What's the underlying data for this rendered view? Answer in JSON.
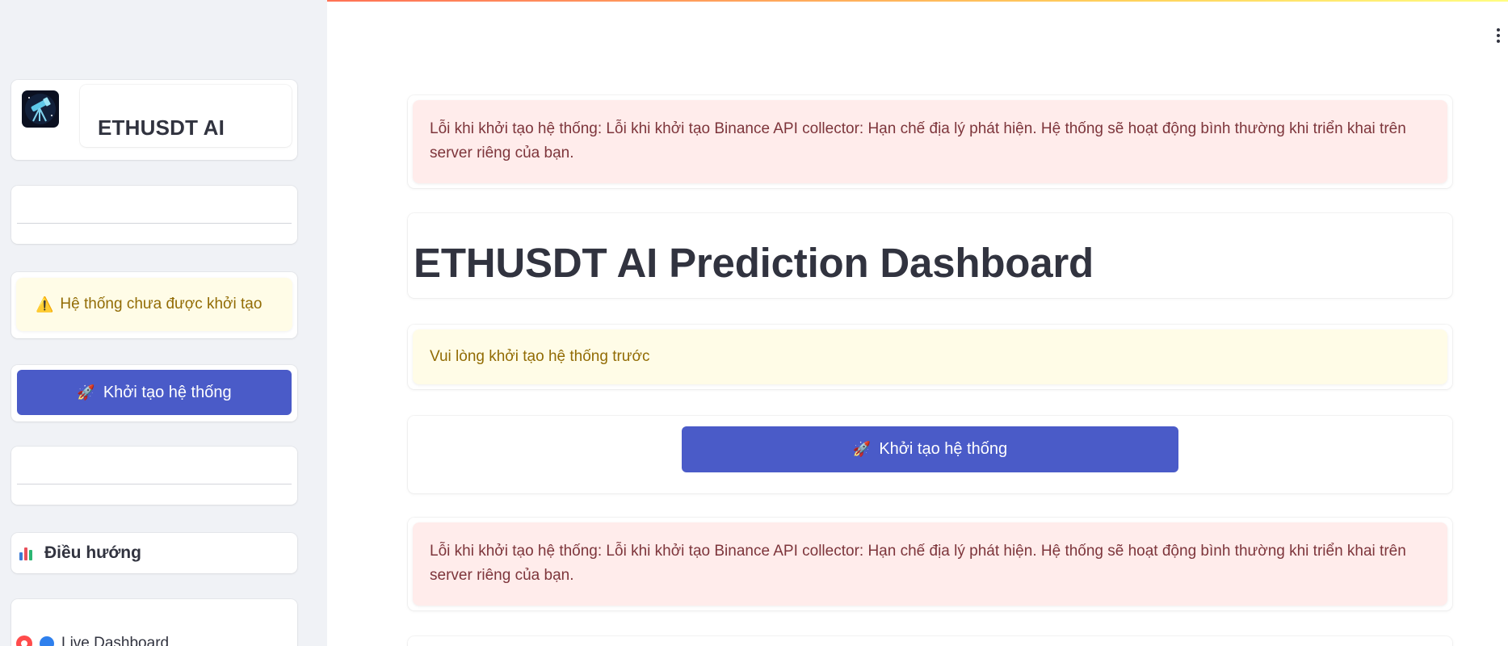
{
  "app": {
    "accent_color": "#4a5bc8",
    "gradient_colors": [
      "#ff4b4b",
      "#ffd25c",
      "#fffd80"
    ]
  },
  "sidebar": {
    "brand_name": "ETHUSDT AI",
    "logo_icon": "telescope-icon",
    "status_warning": {
      "icon": "⚠️",
      "text": "Hệ thống chưa được khởi tạo"
    },
    "init_button": {
      "icon": "🚀",
      "label": "Khởi tạo hệ thống"
    },
    "navigation": {
      "icon": "bar-chart-icon",
      "title": "Điều hướng",
      "items": [
        {
          "icon": "globe-icon",
          "label": "Live Dashboard",
          "selected": true
        }
      ]
    }
  },
  "main": {
    "error_message_top": "Lỗi khi khởi tạo hệ thống: Lỗi khi khởi tạo Binance API collector: Hạn chế địa lý phát hiện. Hệ thống sẽ hoạt động bình thường khi triển khai trên server riêng của bạn.",
    "title": "ETHUSDT AI Prediction Dashboard",
    "init_warning": "Vui lòng khởi tạo hệ thống trước",
    "init_button": {
      "icon": "🚀",
      "label": "Khởi tạo hệ thống"
    },
    "error_message_bottom": "Lỗi khi khởi tạo hệ thống: Lỗi khi khởi tạo Binance API collector: Hạn chế địa lý phát hiện. Hệ thống sẽ hoạt động bình thường khi triển khai trên server riêng của bạn."
  }
}
